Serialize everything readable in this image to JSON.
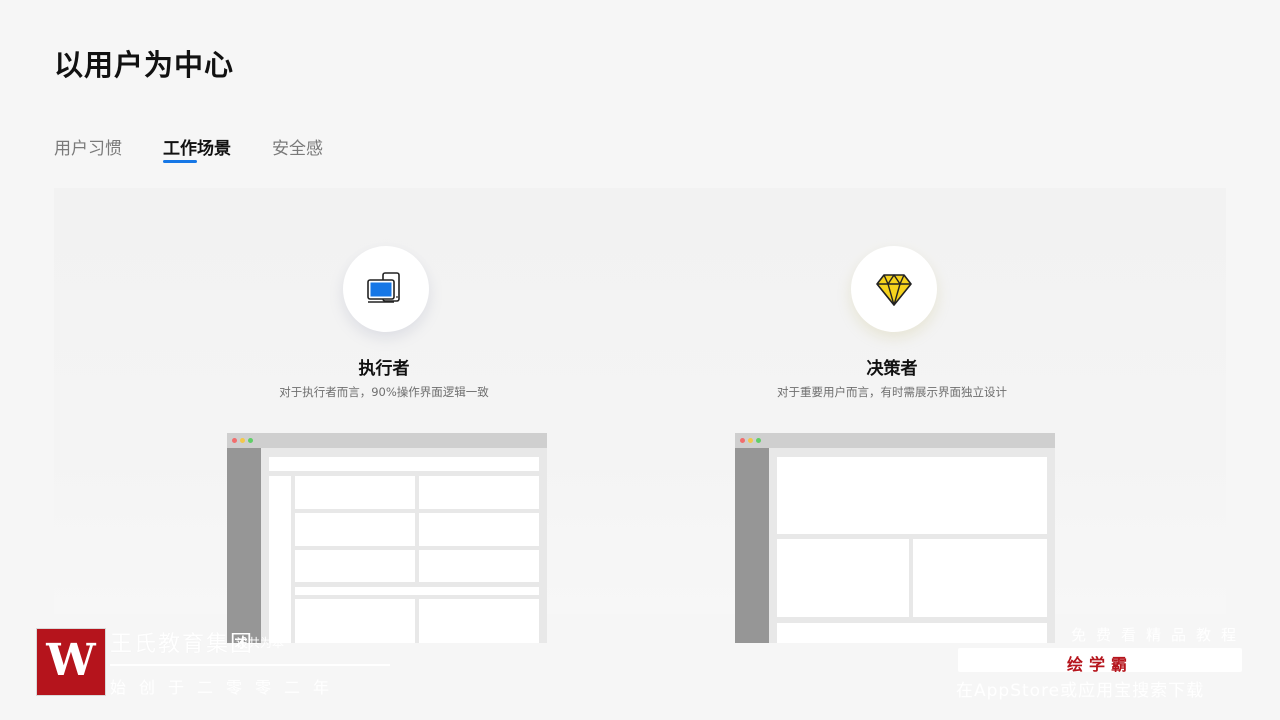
{
  "page": {
    "title": "以用户为中心"
  },
  "tabs": [
    {
      "label": "用户习惯",
      "active": false
    },
    {
      "label": "工作场景",
      "active": true
    },
    {
      "label": "安全感",
      "active": false
    }
  ],
  "roles": [
    {
      "title": "执行者",
      "description": "对于执行者而言，90%操作界面逻辑一致",
      "icon": "devices-icon",
      "accent": "#1677e6"
    },
    {
      "title": "决策者",
      "description": "对于重要用户而言，有时需展示界面独立设计",
      "icon": "diamond-icon",
      "accent": "#f5d21c"
    }
  ],
  "watermark": {
    "logo_letter": "W",
    "name": "王氏教育集团",
    "tag": "设共为本",
    "since": "始创于二零零二年",
    "right_top": "免费看精品教程",
    "brand": "绘学霸",
    "right_bottom": "在AppStore或应用宝搜索下载",
    "brand_color": "#b5141c"
  }
}
